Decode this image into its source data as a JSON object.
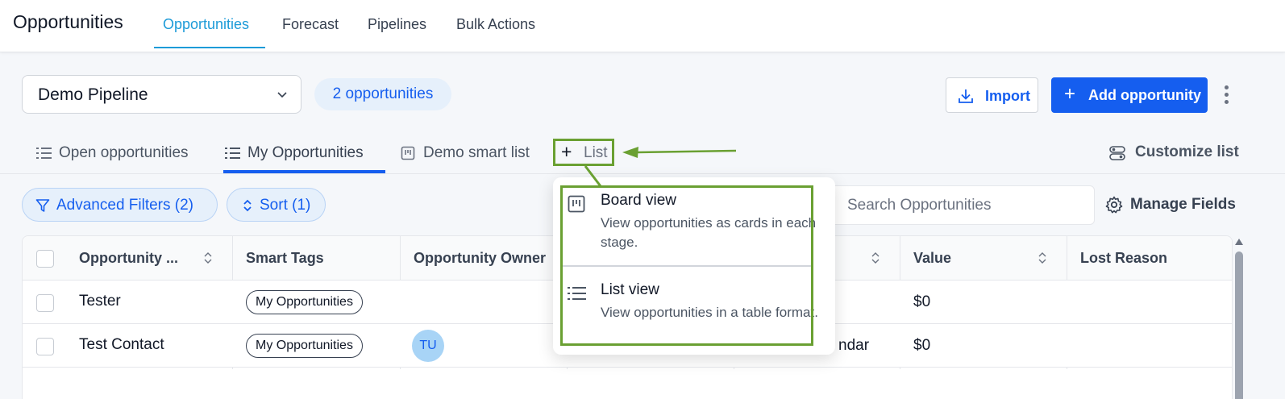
{
  "header": {
    "title": "Opportunities",
    "tabs": [
      {
        "label": "Opportunities",
        "active": true
      },
      {
        "label": "Forecast"
      },
      {
        "label": "Pipelines"
      },
      {
        "label": "Bulk Actions"
      }
    ]
  },
  "toolbar": {
    "pipeline": "Demo Pipeline",
    "count_badge": "2 opportunities",
    "import_label": "Import",
    "add_label": "Add opportunity"
  },
  "list_tabs": [
    {
      "label": "Open opportunities",
      "icon": "list-icon"
    },
    {
      "label": "My Opportunities",
      "icon": "list-icon",
      "active": true
    },
    {
      "label": "Demo smart list",
      "icon": "board-icon"
    }
  ],
  "add_list_label": "List",
  "customize_label": "Customize list",
  "filters": {
    "advanced": "Advanced Filters (2)",
    "sort": "Sort (1)",
    "search_placeholder": "Search Opportunities",
    "manage_fields": "Manage Fields"
  },
  "table": {
    "columns": [
      "Opportunity ...",
      "Smart Tags",
      "Opportunity Owner",
      "Value",
      "Lost Reason"
    ],
    "rows": [
      {
        "name": "Tester",
        "tag": "My Opportunities",
        "owner": "",
        "stage": "",
        "value": "$0"
      },
      {
        "name": "Test Contact",
        "tag": "My Opportunities",
        "owner": "TU",
        "stage": "ndar",
        "value": "$0"
      }
    ]
  },
  "menu": {
    "items": [
      {
        "title": "Board view",
        "desc": "View opportunities as cards in each stage.",
        "icon": "board-icon"
      },
      {
        "title": "List view",
        "desc": "View opportunities in a table format.",
        "icon": "list-icon"
      }
    ]
  },
  "colors": {
    "accent": "#155eef",
    "header_accent": "#1d9bd8",
    "annotation": "#6aa032"
  }
}
